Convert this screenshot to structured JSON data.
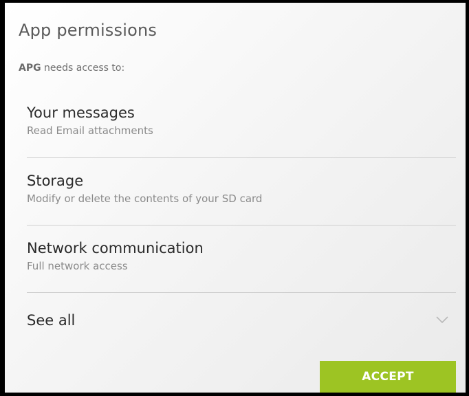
{
  "dialog": {
    "title": "App permissions",
    "app_name": "APG",
    "subtitle_suffix": " needs access to:"
  },
  "permissions": [
    {
      "title": "Your messages",
      "description": "Read Email attachments"
    },
    {
      "title": "Storage",
      "description": "Modify or delete the contents of your SD card"
    },
    {
      "title": "Network communication",
      "description": "Full network access"
    }
  ],
  "see_all": {
    "label": "See all",
    "icon": "chevron-down-icon"
  },
  "accept_button": {
    "label": "ACCEPT",
    "color": "#9dc423"
  }
}
